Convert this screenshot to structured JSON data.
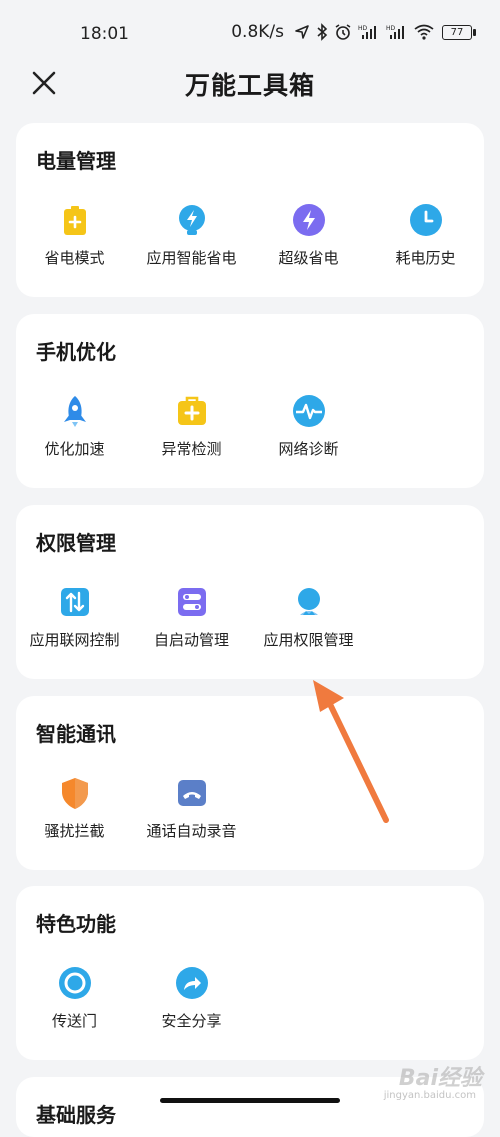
{
  "status": {
    "time": "18:01",
    "speed": "0.8K/s",
    "battery": "77",
    "icons": [
      "location-icon",
      "bluetooth-icon",
      "alarm-icon",
      "signal-hd-1-icon",
      "signal-hd-2-icon",
      "wifi-icon",
      "battery-icon"
    ]
  },
  "header": {
    "title": "万能工具箱",
    "close_icon": "close-icon"
  },
  "sections": [
    {
      "title": "电量管理",
      "items": [
        {
          "label": "省电模式",
          "icon": "battery-plus-icon",
          "color": "#F5C518"
        },
        {
          "label": "应用智能省电",
          "icon": "bulb-bolt-icon",
          "color": "#2EA8E8"
        },
        {
          "label": "超级省电",
          "icon": "bolt-circle-icon",
          "color": "#7B6CF0"
        },
        {
          "label": "耗电历史",
          "icon": "clock-icon",
          "color": "#2EA8E8"
        }
      ]
    },
    {
      "title": "手机优化",
      "items": [
        {
          "label": "优化加速",
          "icon": "rocket-icon",
          "color": "#2E8BE8"
        },
        {
          "label": "异常检测",
          "icon": "medkit-icon",
          "color": "#F5C518"
        },
        {
          "label": "网络诊断",
          "icon": "pulse-icon",
          "color": "#2EA8E8"
        }
      ]
    },
    {
      "title": "权限管理",
      "items": [
        {
          "label": "应用联网控制",
          "icon": "updown-arrows-icon",
          "color": "#2EA8E8"
        },
        {
          "label": "自启动管理",
          "icon": "toggle-icon",
          "color": "#7B6CF0"
        },
        {
          "label": "应用权限管理",
          "icon": "shield-person-icon",
          "color": "#2EA8E8"
        }
      ]
    },
    {
      "title": "智能通讯",
      "items": [
        {
          "label": "骚扰拦截",
          "icon": "shield-icon",
          "color": "#F5882C"
        },
        {
          "label": "通话自动录音",
          "icon": "phone-record-icon",
          "color": "#5B7FC8"
        }
      ]
    },
    {
      "title": "特色功能",
      "items": [
        {
          "label": "传送门",
          "icon": "portal-ring-icon",
          "color": "#2EA8E8"
        },
        {
          "label": "安全分享",
          "icon": "share-icon",
          "color": "#2EA8E8"
        }
      ]
    },
    {
      "title": "基础服务",
      "items": []
    }
  ],
  "watermark": {
    "brand": "Bai经验",
    "url": "jingyan.baidu.com"
  }
}
